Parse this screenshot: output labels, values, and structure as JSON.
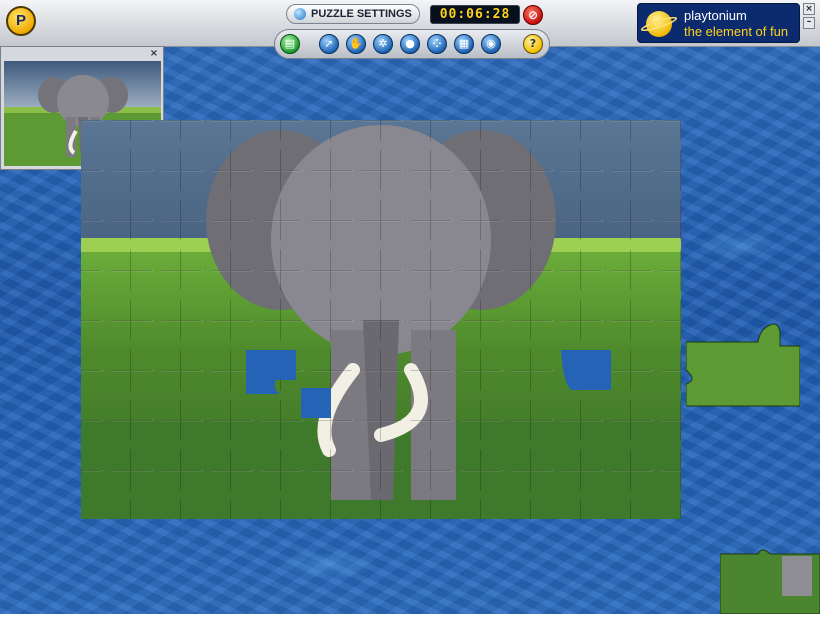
{
  "toolbar": {
    "settings_label": "PUZZLE SETTINGS",
    "timer": "00:06:28",
    "tools": [
      {
        "icon": "save-icon",
        "glyph": "▤"
      },
      {
        "icon": "pointer-icon",
        "glyph": "➚"
      },
      {
        "icon": "hand-icon",
        "glyph": "✋"
      },
      {
        "icon": "scatter-icon",
        "glyph": "✲"
      },
      {
        "icon": "edge-pieces-icon",
        "glyph": "●"
      },
      {
        "icon": "shuffle-icon",
        "glyph": "⁘"
      },
      {
        "icon": "sort-icon",
        "glyph": "▦"
      },
      {
        "icon": "ghost-image-icon",
        "glyph": "◉"
      },
      {
        "icon": "help-icon",
        "glyph": "?"
      }
    ],
    "stop_glyph": "⊘"
  },
  "brand": {
    "logo_text": "P",
    "name": "playtonium",
    "tagline": "the element of fun"
  },
  "window": {
    "close_glyph": "×",
    "minimize_glyph": "–"
  },
  "preview": {
    "close_glyph": "×",
    "image": "elephant-preview"
  },
  "puzzle": {
    "image": "african-elephant-savanna",
    "grid_cols": 12,
    "grid_rows": 8
  },
  "colors": {
    "water": "#2563b6",
    "toolbar": "#d6d9de",
    "timer_text": "#ffd21a",
    "brand_bg": "#0c2a6e"
  }
}
